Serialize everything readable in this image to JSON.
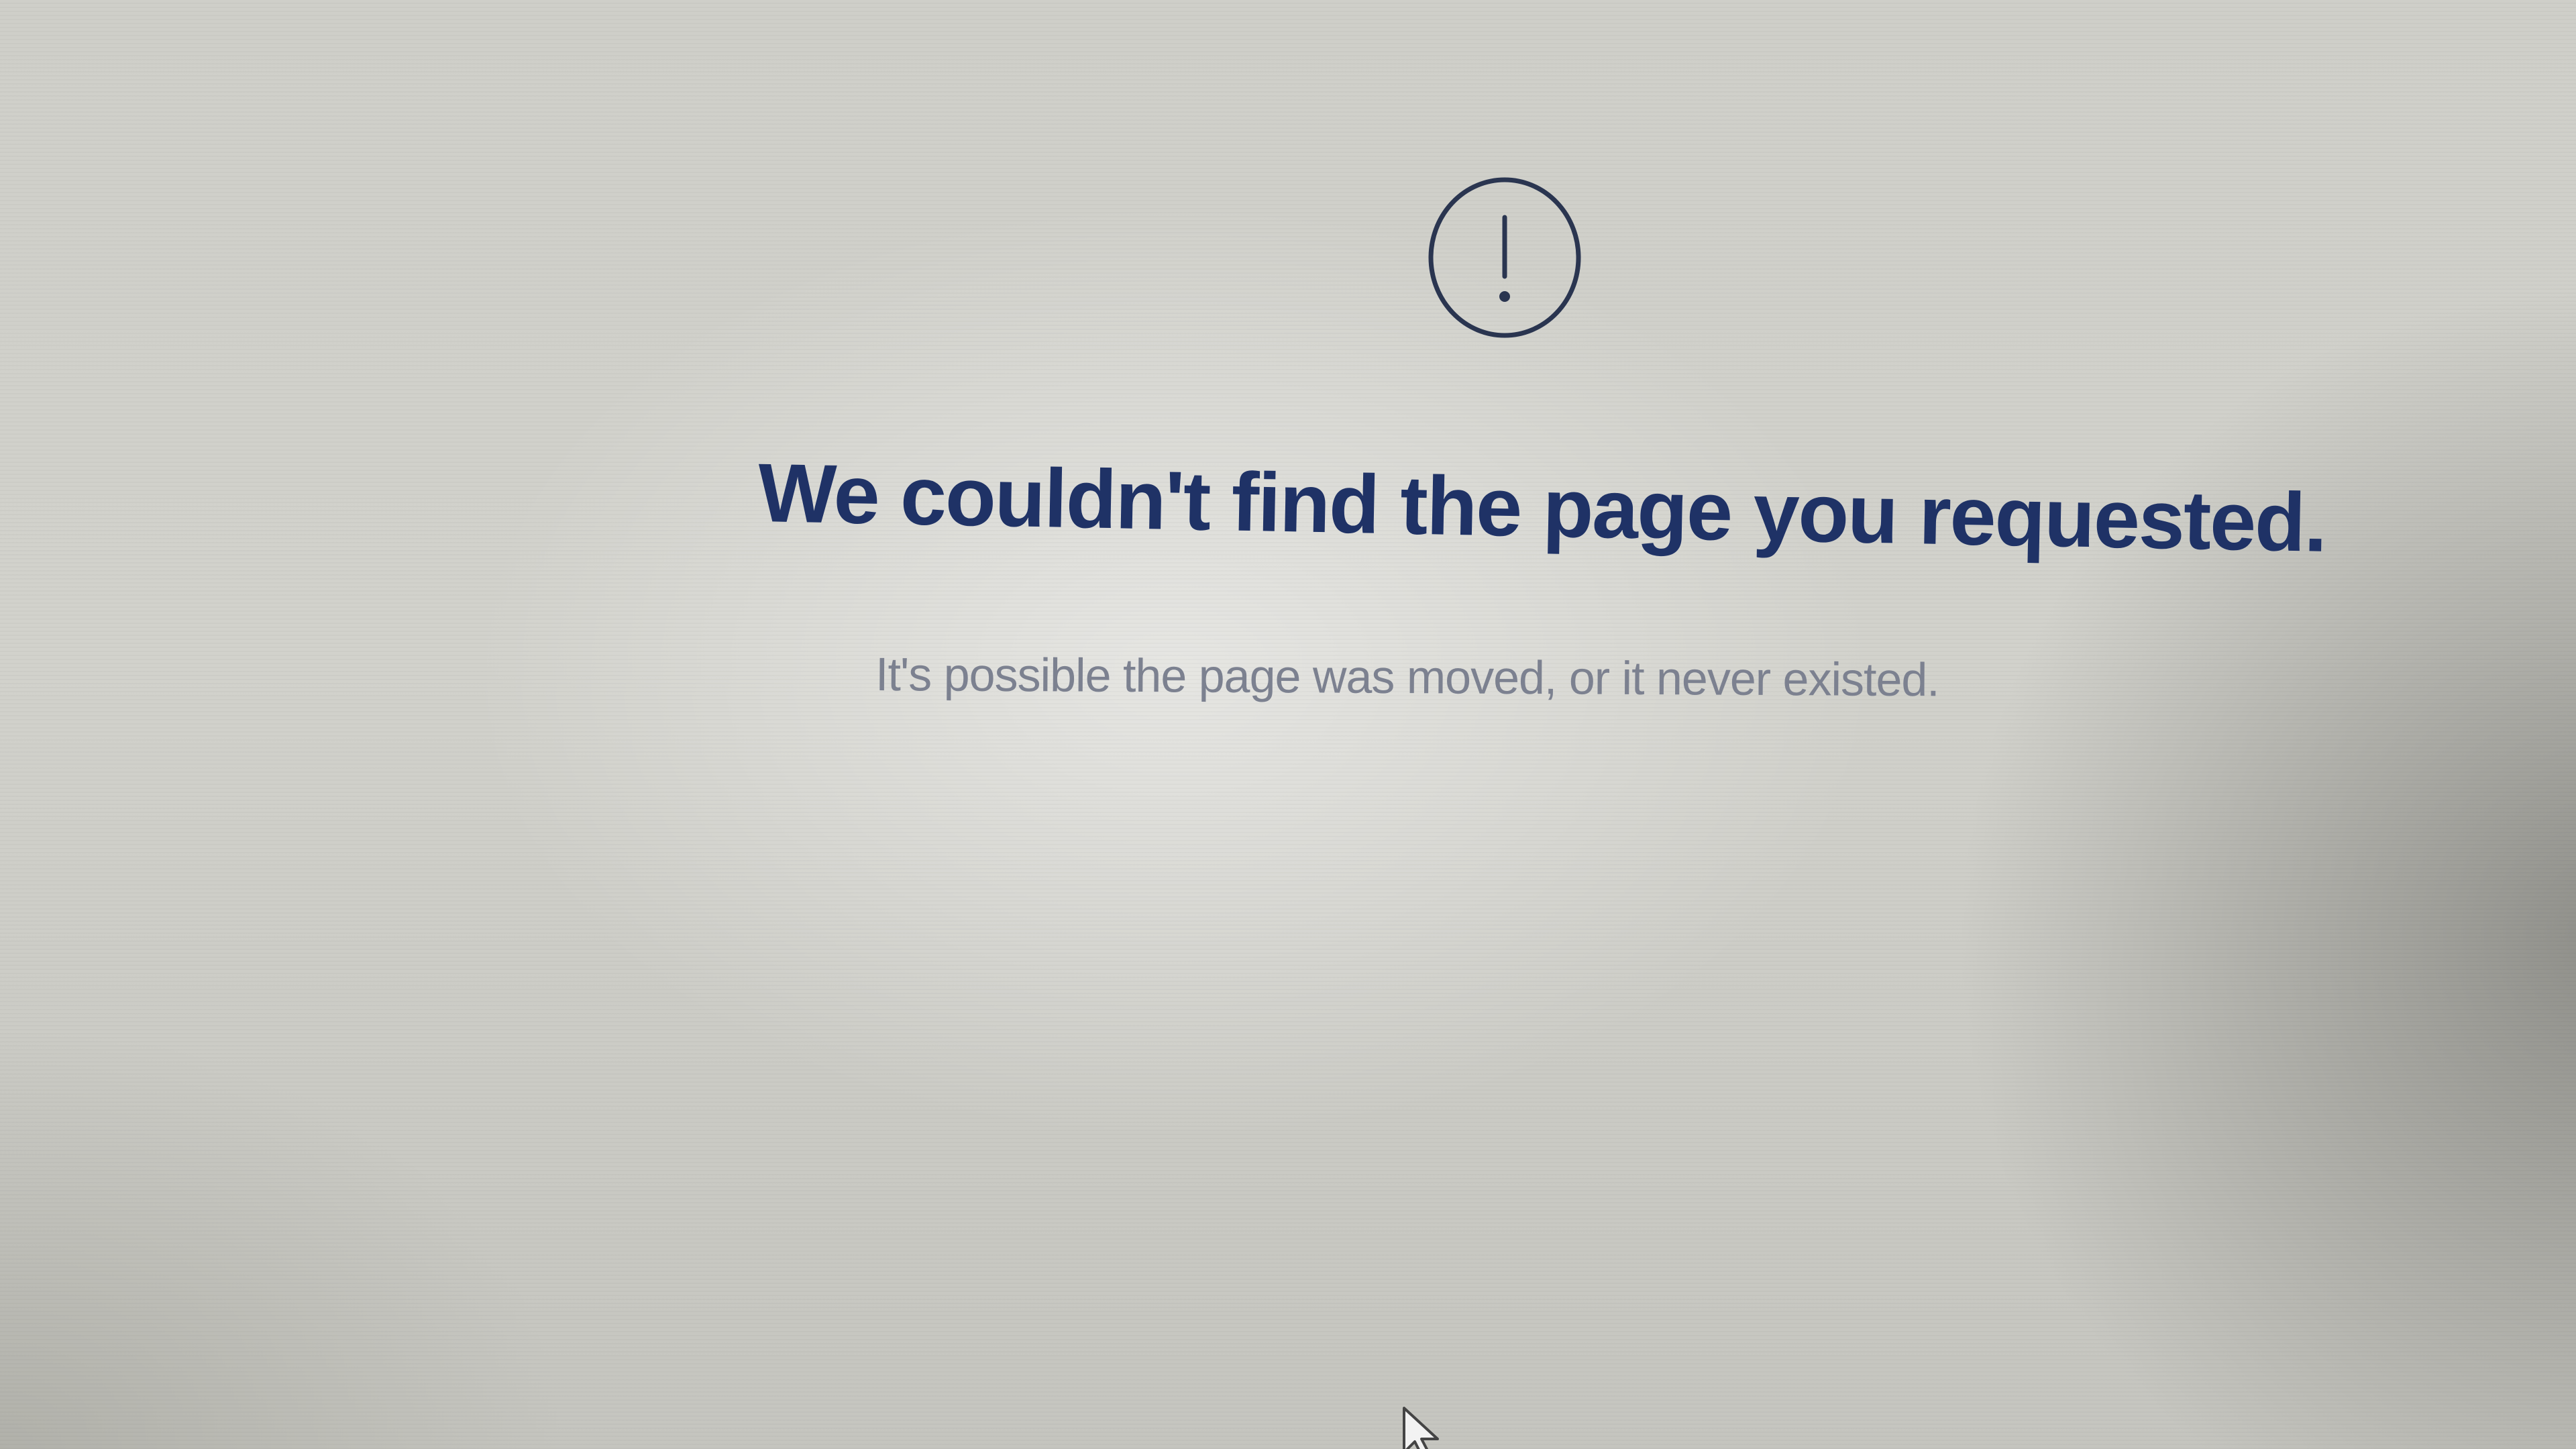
{
  "error_page": {
    "icon": "exclamation-circle-icon",
    "heading": "We couldn't find the page you requested.",
    "subtext": "It's possible the page was moved, or it never existed."
  },
  "cursor": {
    "icon": "mouse-pointer-icon"
  },
  "colors": {
    "heading": "#1f3266",
    "subtext": "#7c8190",
    "icon_stroke": "#2a3550",
    "background": "#d0d0ca"
  }
}
